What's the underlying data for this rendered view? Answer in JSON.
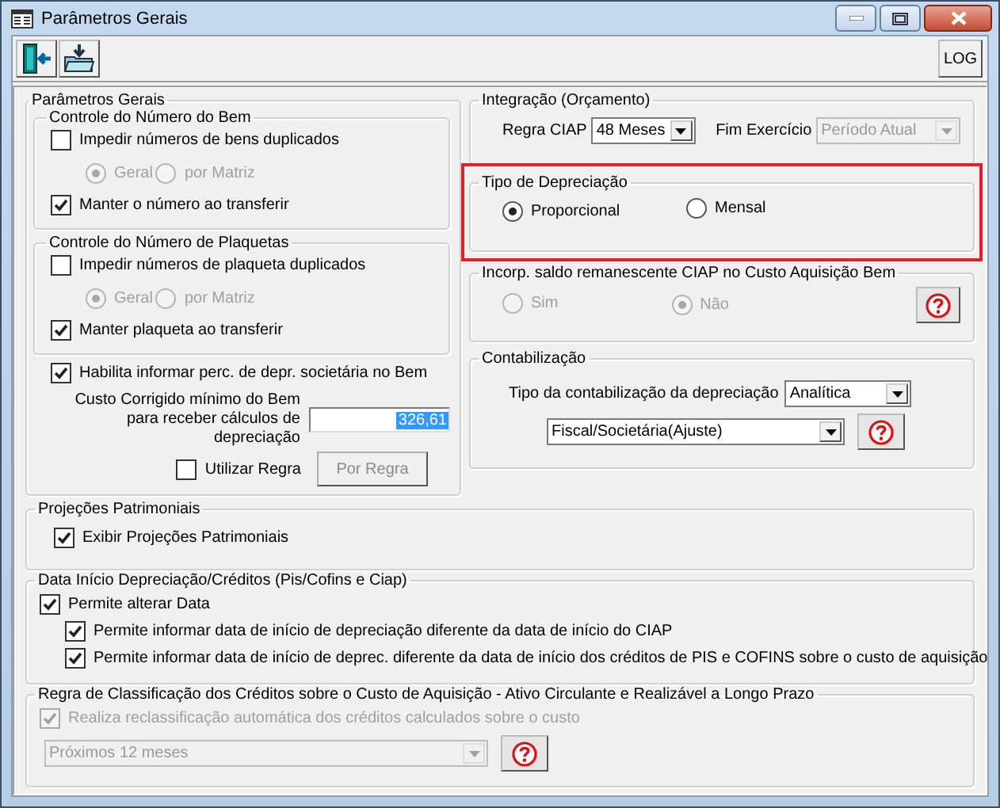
{
  "window": {
    "title": "Parâmetros Gerais"
  },
  "toolbar": {
    "log_button": "LOG"
  },
  "left": {
    "title": "Parâmetros Gerais",
    "groups": [
      {
        "title": "Controle do Número do Bem",
        "prevent": {
          "label": "Impedir números de bens duplicados",
          "checked": false
        },
        "scope_disabled": true,
        "scope": [
          {
            "label": "Geral",
            "selected": true
          },
          {
            "label": "por Matriz",
            "selected": false
          }
        ],
        "keep": {
          "label": "Manter o número ao transferir",
          "checked": true
        }
      },
      {
        "title": "Controle do Número de Plaquetas",
        "prevent": {
          "label": "Impedir números de plaqueta duplicados",
          "checked": false
        },
        "scope_disabled": true,
        "scope": [
          {
            "label": "Geral",
            "selected": true
          },
          {
            "label": "por Matriz",
            "selected": false
          }
        ],
        "keep": {
          "label": "Manter plaqueta ao transferir",
          "checked": true
        }
      }
    ],
    "enable_percent": {
      "label": "Habilita informar perc. de depr. societária no Bem",
      "checked": true
    },
    "min_cost": {
      "label": "Custo Corrigido mínimo do Bem para receber cálculos de depreciação",
      "value": "326,61"
    },
    "use_rule": {
      "label": "Utilizar Regra",
      "checked": false
    },
    "rule_button": {
      "label": "Por Regra",
      "disabled": true
    }
  },
  "integration": {
    "title": "Integração (Orçamento)",
    "ciap_rule": {
      "label": "Regra CIAP",
      "value": "48 Meses",
      "disabled": false
    },
    "fiscal_year_end": {
      "label": "Fim Exercício",
      "value": "Período Atual",
      "disabled": true
    }
  },
  "depreciation_type": {
    "title": "Tipo de Depreciação",
    "highlighted": true,
    "options": [
      {
        "label": "Proporcional",
        "selected": true
      },
      {
        "label": "Mensal",
        "selected": false
      }
    ]
  },
  "ciap_balance": {
    "title": "Incorp. saldo remanescente CIAP no Custo Aquisição Bem",
    "disabled": true,
    "options": [
      {
        "label": "Sim",
        "selected": false
      },
      {
        "label": "Não",
        "selected": true
      }
    ]
  },
  "accounting": {
    "title": "Contabilização",
    "type": {
      "label": "Tipo da contabilização da depreciação",
      "value": "Analítica"
    },
    "book": {
      "value": "Fiscal/Societária(Ajuste)"
    }
  },
  "projections": {
    "title": "Projeções Patrimoniais",
    "show": {
      "label": "Exibir Projeções Patrimoniais",
      "checked": true
    }
  },
  "start_date": {
    "title": "Data Início Depreciação/Créditos (Pis/Cofins e Ciap)",
    "allow": {
      "label": "Permite alterar Data",
      "checked": true
    },
    "sub": [
      {
        "label": "Permite informar data de início de depreciação diferente da data de início do CIAP",
        "checked": true
      },
      {
        "label": "Permite informar data de início de deprec. diferente da data de início dos créditos de PIS e COFINS sobre o custo de aquisição",
        "checked": true
      }
    ]
  },
  "classification": {
    "title": "Regra de Classificação dos Créditos sobre o Custo de Aquisição - Ativo Circulante e Realizável a Longo Prazo",
    "disabled": true,
    "auto": {
      "label": "Realiza reclassificação automática dos créditos calculados sobre o custo",
      "checked": true
    },
    "period": {
      "value": "Próximos 12 meses"
    }
  }
}
